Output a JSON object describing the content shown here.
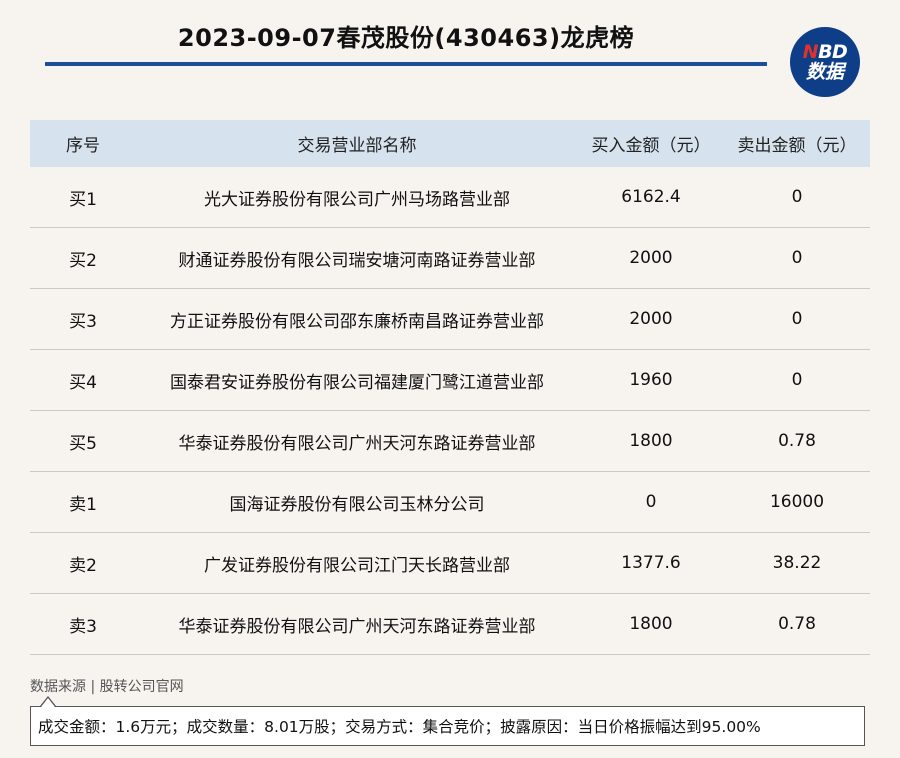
{
  "header": {
    "title": "2023-09-07春茂股份(430463)龙虎榜",
    "logo_top": "BD",
    "logo_top_accent": "N",
    "logo_bottom": "数据"
  },
  "table": {
    "columns": [
      "序号",
      "交易营业部名称",
      "买入金额（元）",
      "卖出金额（元）"
    ],
    "rows": [
      {
        "seq": "买1",
        "name": "光大证券股份有限公司广州马场路营业部",
        "buy": "6162.4",
        "sell": "0"
      },
      {
        "seq": "买2",
        "name": "财通证券股份有限公司瑞安塘河南路证券营业部",
        "buy": "2000",
        "sell": "0"
      },
      {
        "seq": "买3",
        "name": "方正证券股份有限公司邵东廉桥南昌路证券营业部",
        "buy": "2000",
        "sell": "0"
      },
      {
        "seq": "买4",
        "name": "国泰君安证券股份有限公司福建厦门鹭江道营业部",
        "buy": "1960",
        "sell": "0"
      },
      {
        "seq": "买5",
        "name": "华泰证券股份有限公司广州天河东路证券营业部",
        "buy": "1800",
        "sell": "0.78"
      },
      {
        "seq": "卖1",
        "name": "国海证券股份有限公司玉林分公司",
        "buy": "0",
        "sell": "16000"
      },
      {
        "seq": "卖2",
        "name": "广发证券股份有限公司江门天长路营业部",
        "buy": "1377.6",
        "sell": "38.22"
      },
      {
        "seq": "卖3",
        "name": "华泰证券股份有限公司广州天河东路证券营业部",
        "buy": "1800",
        "sell": "0.78"
      }
    ]
  },
  "footer": {
    "source": "数据来源 | 股转公司官网",
    "note": "成交金额：1.6万元；成交数量：8.01万股；交易方式：集合竞价；披露原因：当日价格振幅达到95.00%"
  },
  "colors": {
    "accent": "#1a4f9c",
    "header_bg": "#d6e3ee",
    "logo_bg": "#0f3e88",
    "logo_accent": "#e0322b"
  }
}
